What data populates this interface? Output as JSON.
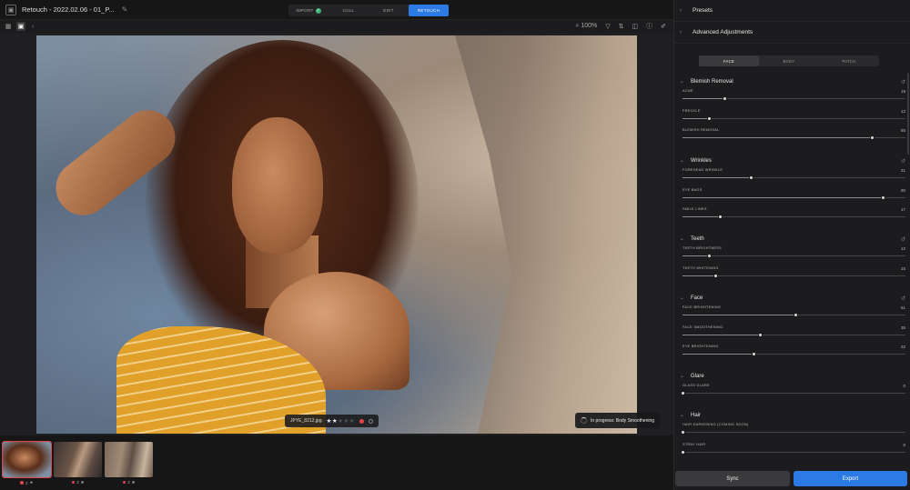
{
  "app": {
    "title": "Retouch - 2022.02.06 - 01_P...",
    "app_icon": "retouch-app-icon",
    "steps": [
      {
        "label": "IMPORT",
        "done": true
      },
      {
        "label": "CULL",
        "done": false
      },
      {
        "label": "EDIT",
        "done": false
      },
      {
        "label": "RETOUCH",
        "done": false,
        "active": true
      }
    ]
  },
  "toolbar": {
    "zoom": "100%"
  },
  "viewer": {
    "file_name": "JPYE_8212.jpg",
    "rating": 2,
    "max_rating": 5,
    "progress_text": "In progress: Body Smoothening"
  },
  "filmstrip": [
    {
      "selected": true,
      "rating": "2"
    },
    {
      "selected": false,
      "rating": "2"
    },
    {
      "selected": false,
      "rating": "2"
    }
  ],
  "panel": {
    "presets_label": "Presets",
    "advanced_label": "Advanced Adjustments",
    "tabs": [
      "FACE",
      "BODY",
      "PATCH"
    ],
    "active_tab": "FACE",
    "sections": [
      {
        "title": "Blemish Removal",
        "sliders": [
          {
            "label": "ACNE",
            "value": "19",
            "pct": 0.19
          },
          {
            "label": "FRECKLE",
            "value": "12",
            "pct": 0.12
          },
          {
            "label": "BLEMISH REMOVAL",
            "value": "85",
            "pct": 0.85
          }
        ]
      },
      {
        "title": "Wrinkles",
        "sliders": [
          {
            "label": "FOREHEAD WRINKLE",
            "value": "31",
            "pct": 0.31
          },
          {
            "label": "EYE BAGS",
            "value": "90",
            "pct": 0.9
          },
          {
            "label": "SMILE LINES",
            "value": "17",
            "pct": 0.17
          }
        ]
      },
      {
        "title": "Teeth",
        "sliders": [
          {
            "label": "TEETH BRIGHTNESS",
            "value": "12",
            "pct": 0.12
          },
          {
            "label": "TEETH WHITENING",
            "value": "15",
            "pct": 0.15
          }
        ]
      },
      {
        "title": "Face",
        "sliders": [
          {
            "label": "FACE BRIGHTENING",
            "value": "51",
            "pct": 0.51
          },
          {
            "label": "FACE SMOOTHENING",
            "value": "35",
            "pct": 0.35
          },
          {
            "label": "EYE BRIGHTENING",
            "value": "32",
            "pct": 0.32
          }
        ]
      },
      {
        "title": "Glare",
        "sliders": [
          {
            "label": "GLASS GLARE",
            "value": "0",
            "pct": 0
          }
        ]
      },
      {
        "title": "Hair",
        "sliders": [
          {
            "label": "HAIR DARKENING (COMING SOON)",
            "value": "",
            "pct": 0
          },
          {
            "label": "STRAY HAIR",
            "value": "0",
            "pct": 0
          }
        ]
      }
    ],
    "sync_label": "Sync",
    "export_label": "Export"
  },
  "colors": {
    "accent": "#2c7be5",
    "flag_red": "#e0454a",
    "done_green": "#3bb273"
  }
}
